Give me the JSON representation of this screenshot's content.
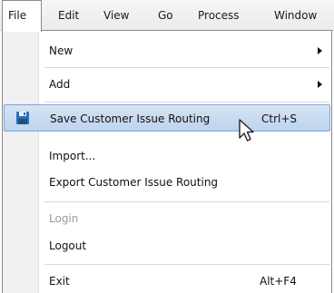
{
  "menubar": {
    "items": [
      {
        "label": "File"
      },
      {
        "label": "Edit"
      },
      {
        "label": "View"
      },
      {
        "label": "Go"
      },
      {
        "label": "Process"
      },
      {
        "label": "Window"
      }
    ]
  },
  "menu": {
    "new_label": "New",
    "add_label": "Add",
    "save_label": "Save Customer Issue Routing",
    "save_shortcut": "Ctrl+S",
    "import_label": "Import...",
    "export_label": "Export Customer Issue Routing",
    "login_label": "Login",
    "logout_label": "Logout",
    "exit_label": "Exit",
    "exit_shortcut": "Alt+F4"
  },
  "colors": {
    "highlight": "#bdd3ee",
    "highlight_border": "#7fa6d6",
    "save_icon": "#2d6fb3"
  }
}
